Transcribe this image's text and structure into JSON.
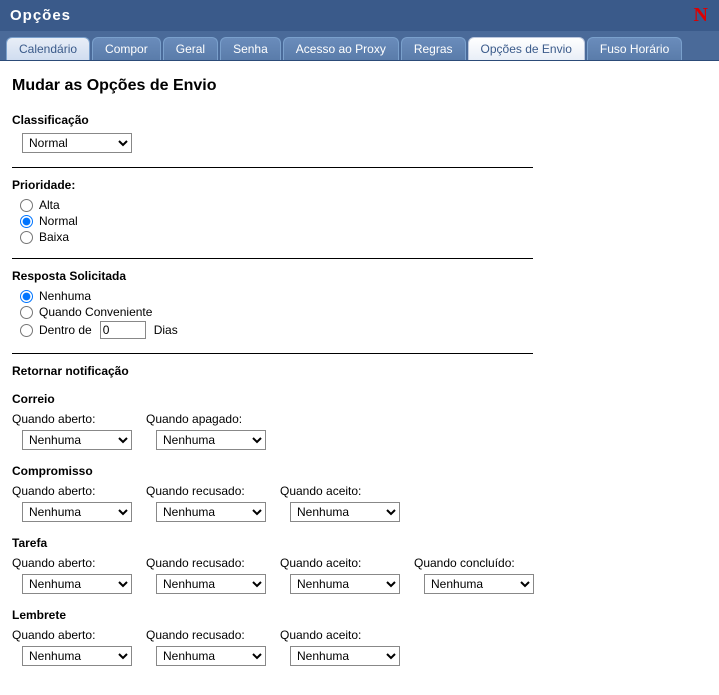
{
  "title": "Opções",
  "logo": "N",
  "tabs": [
    {
      "label": "Calendário",
      "active": false,
      "first": true
    },
    {
      "label": "Compor",
      "active": false
    },
    {
      "label": "Geral",
      "active": false
    },
    {
      "label": "Senha",
      "active": false
    },
    {
      "label": "Acesso ao Proxy",
      "active": false
    },
    {
      "label": "Regras",
      "active": false
    },
    {
      "label": "Opções de Envio",
      "active": true
    },
    {
      "label": "Fuso Horário",
      "active": false
    }
  ],
  "heading": "Mudar as Opções de Envio",
  "classification": {
    "label": "Classificação",
    "value": "Normal"
  },
  "priority": {
    "label": "Prioridade:",
    "options": [
      {
        "label": "Alta",
        "checked": false
      },
      {
        "label": "Normal",
        "checked": true
      },
      {
        "label": "Baixa",
        "checked": false
      }
    ]
  },
  "reply": {
    "label": "Resposta Solicitada",
    "options": {
      "none": {
        "label": "Nenhuma",
        "checked": true
      },
      "convenient": {
        "label": "Quando Conveniente",
        "checked": false
      },
      "within": {
        "label": "Dentro de",
        "checked": false,
        "value": "0",
        "suffix": "Dias"
      }
    }
  },
  "return_notify": {
    "label": "Retornar notificação",
    "mail": {
      "heading": "Correio",
      "opened": {
        "label": "Quando aberto:",
        "value": "Nenhuma"
      },
      "deleted": {
        "label": "Quando apagado:",
        "value": "Nenhuma"
      }
    },
    "appt": {
      "heading": "Compromisso",
      "opened": {
        "label": "Quando aberto:",
        "value": "Nenhuma"
      },
      "declined": {
        "label": "Quando recusado:",
        "value": "Nenhuma"
      },
      "accepted": {
        "label": "Quando aceito:",
        "value": "Nenhuma"
      }
    },
    "task": {
      "heading": "Tarefa",
      "opened": {
        "label": "Quando aberto:",
        "value": "Nenhuma"
      },
      "declined": {
        "label": "Quando recusado:",
        "value": "Nenhuma"
      },
      "accepted": {
        "label": "Quando aceito:",
        "value": "Nenhuma"
      },
      "completed": {
        "label": "Quando concluído:",
        "value": "Nenhuma"
      }
    },
    "note": {
      "heading": "Lembrete",
      "opened": {
        "label": "Quando aberto:",
        "value": "Nenhuma"
      },
      "declined": {
        "label": "Quando recusado:",
        "value": "Nenhuma"
      },
      "accepted": {
        "label": "Quando aceito:",
        "value": "Nenhuma"
      }
    }
  }
}
